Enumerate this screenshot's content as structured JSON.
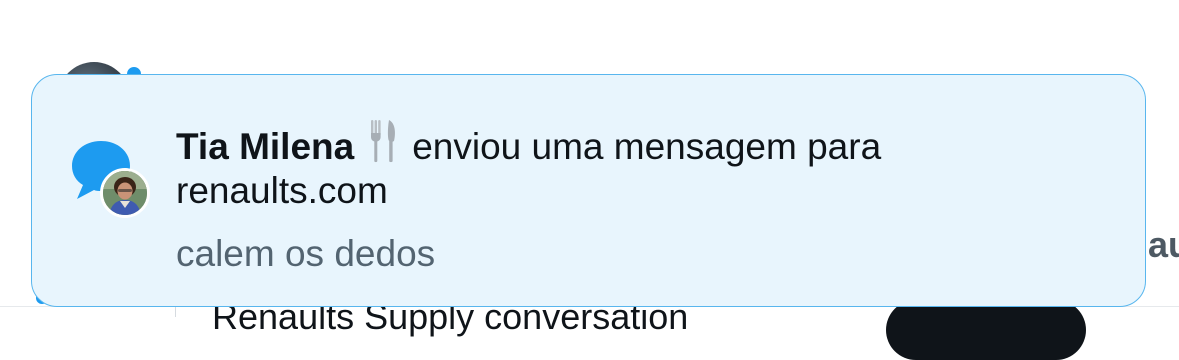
{
  "notification": {
    "sender_name": "Tia Milena",
    "sender_emoji": "fork-and-knife",
    "action_text": "enviou uma mensagem para",
    "recipient": "renaults.com",
    "message_preview": "calem os dedos",
    "icon": "message-bubble-icon",
    "accent_color": "#1d9bf0",
    "background_color": "#e8f5fd",
    "border_color": "#58b6ee"
  },
  "background": {
    "side_text": "au",
    "bottom_text": "Renaults Supply conversation"
  }
}
